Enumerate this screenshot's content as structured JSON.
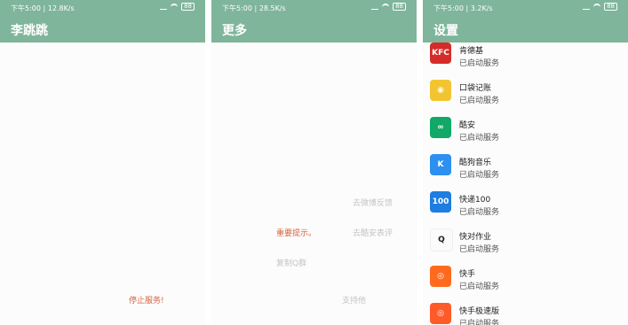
{
  "panels": [
    {
      "status": {
        "time": "下午5:00",
        "speed": "12.8K/s",
        "battery": "88"
      },
      "title": "李跳跳",
      "stop_label": "停止服务!"
    },
    {
      "status": {
        "time": "下午5:00",
        "speed": "28.5K/s",
        "battery": "88"
      },
      "title": "更多",
      "links": {
        "weibo": "去微博反馈",
        "important": "重要提示。",
        "coolapk": "去酷安表评",
        "qq_group": "复制Q群",
        "support": "支持他"
      }
    },
    {
      "status": {
        "time": "下午5:00",
        "speed": "3.2K/s",
        "battery": "88"
      },
      "title": "设置",
      "apps": [
        {
          "name": "肯德基",
          "status": "已启动服务",
          "icon": "kfc-icon",
          "color": "#d62b2b",
          "glyph": "KFC"
        },
        {
          "name": "口袋记账",
          "status": "已启动服务",
          "icon": "pocket-ledger-icon",
          "color": "#f2c530",
          "glyph": "◉"
        },
        {
          "name": "酷安",
          "status": "已启动服务",
          "icon": "coolapk-icon",
          "color": "#11a868",
          "glyph": "∞"
        },
        {
          "name": "酷狗音乐",
          "status": "已启动服务",
          "icon": "kugou-icon",
          "color": "#2d8ff0",
          "glyph": "K"
        },
        {
          "name": "快递100",
          "status": "已启动服务",
          "icon": "kuaidi100-icon",
          "color": "#1e7de0",
          "glyph": "100"
        },
        {
          "name": "快对作业",
          "status": "已启动服务",
          "icon": "kuaidui-icon",
          "color": "#fbfbfb",
          "glyph": "Q"
        },
        {
          "name": "快手",
          "status": "已启动服务",
          "icon": "kuaishou-icon",
          "color": "#ff6a1f",
          "glyph": "◎"
        },
        {
          "name": "快手极速版",
          "status": "已启动服务",
          "icon": "kuaishou-lite-icon",
          "color": "#ff5a2a",
          "glyph": "◎"
        }
      ]
    }
  ],
  "colors": {
    "header": "#7fb59b",
    "accent_red": "#d1653e",
    "muted": "#c4c4c4"
  }
}
